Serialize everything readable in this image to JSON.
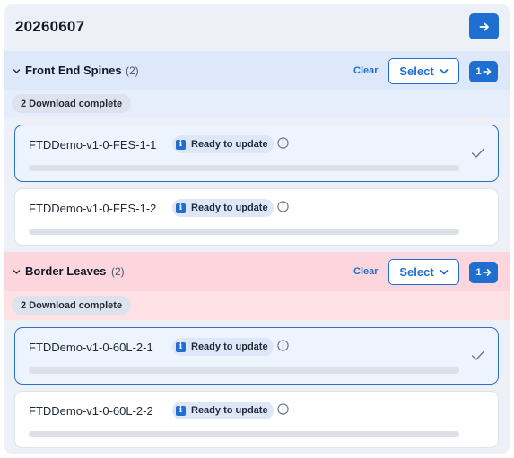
{
  "header": {
    "date": "20260607",
    "arrow_icon": "arrow-right-icon"
  },
  "colors": {
    "accent": "#1f6fd1",
    "spines_header_bg": "#dde9fb",
    "leaves_header_bg": "#fcd6dc"
  },
  "groups": [
    {
      "name": "Front End Spines",
      "count": "(2)",
      "clear_label": "Clear",
      "select_label": "Select",
      "next_label": "1",
      "status": "2 Download complete",
      "devices": [
        {
          "name": "FTDDemo-v1-0-FES-1-1",
          "badge": "Ready to update",
          "selected": true,
          "progress": 0
        },
        {
          "name": "FTDDemo-v1-0-FES-1-2",
          "badge": "Ready to update",
          "selected": false,
          "progress": 0
        }
      ]
    },
    {
      "name": "Border Leaves",
      "count": "(2)",
      "clear_label": "Clear",
      "select_label": "Select",
      "next_label": "1",
      "status": "2 Download complete",
      "devices": [
        {
          "name": "FTDDemo-v1-0-60L-2-1",
          "badge": "Ready to update",
          "selected": true,
          "progress": 0
        },
        {
          "name": "FTDDemo-v1-0-60L-2-2",
          "badge": "Ready to update",
          "selected": false,
          "progress": 0
        }
      ]
    }
  ]
}
